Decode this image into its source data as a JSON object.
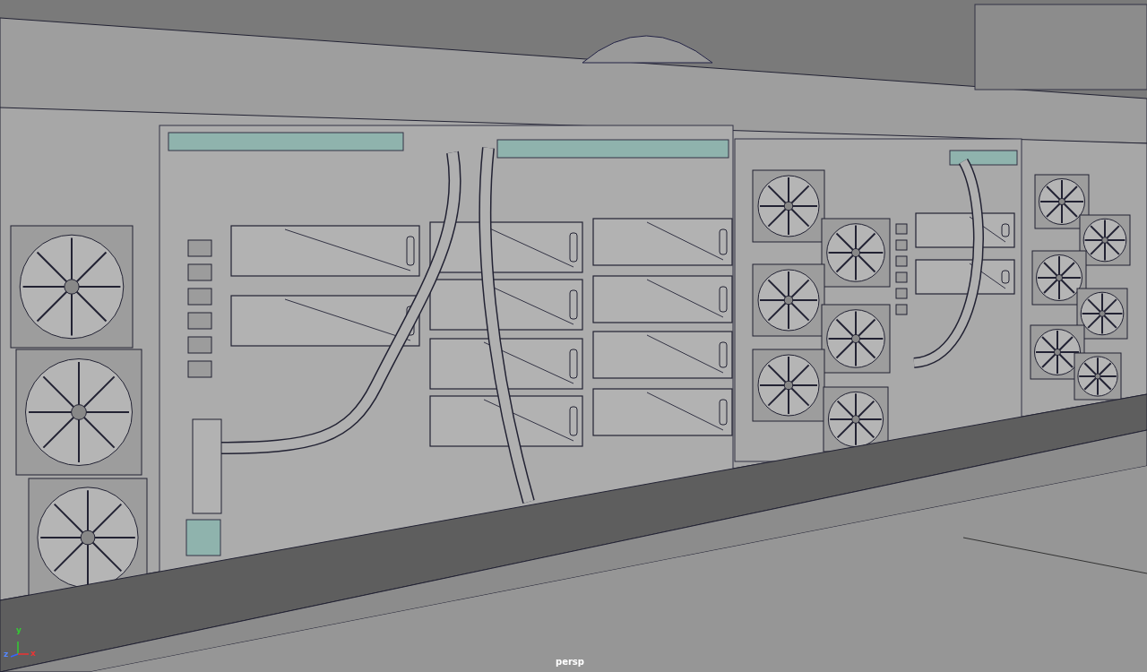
{
  "viewport": {
    "camera_label": "persp",
    "axis_labels": [
      "y",
      "z",
      "x"
    ]
  }
}
